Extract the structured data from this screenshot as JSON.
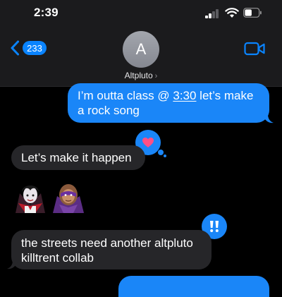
{
  "status_bar": {
    "time": "2:39",
    "icons": [
      "signal-icon",
      "wifi-icon",
      "battery-icon"
    ]
  },
  "nav": {
    "back_count": "233",
    "avatar_initial": "A",
    "contact_name": "Altpluto",
    "contact_chevron": "›",
    "icons": [
      "back-chevron-icon",
      "video-call-icon"
    ]
  },
  "messages": [
    {
      "direction": "outgoing",
      "text_before": "I’m outta class @ ",
      "time_link": "3:30",
      "text_after": " let’s make a rock song",
      "tapback_from_contact": "heart"
    },
    {
      "direction": "incoming",
      "text": "Let’s make it happen"
    },
    {
      "direction": "incoming",
      "emojis": [
        "vampire-emoji",
        "supervillain-emoji"
      ]
    },
    {
      "direction": "incoming",
      "text": "the streets need another altpluto killtrent collab",
      "tapback_from_me": "exclamation"
    }
  ],
  "colors": {
    "outgoing_bubble": "#1a86f8",
    "incoming_bubble": "#262629",
    "accent": "#0a84ff",
    "heart": "#ff4f85"
  }
}
